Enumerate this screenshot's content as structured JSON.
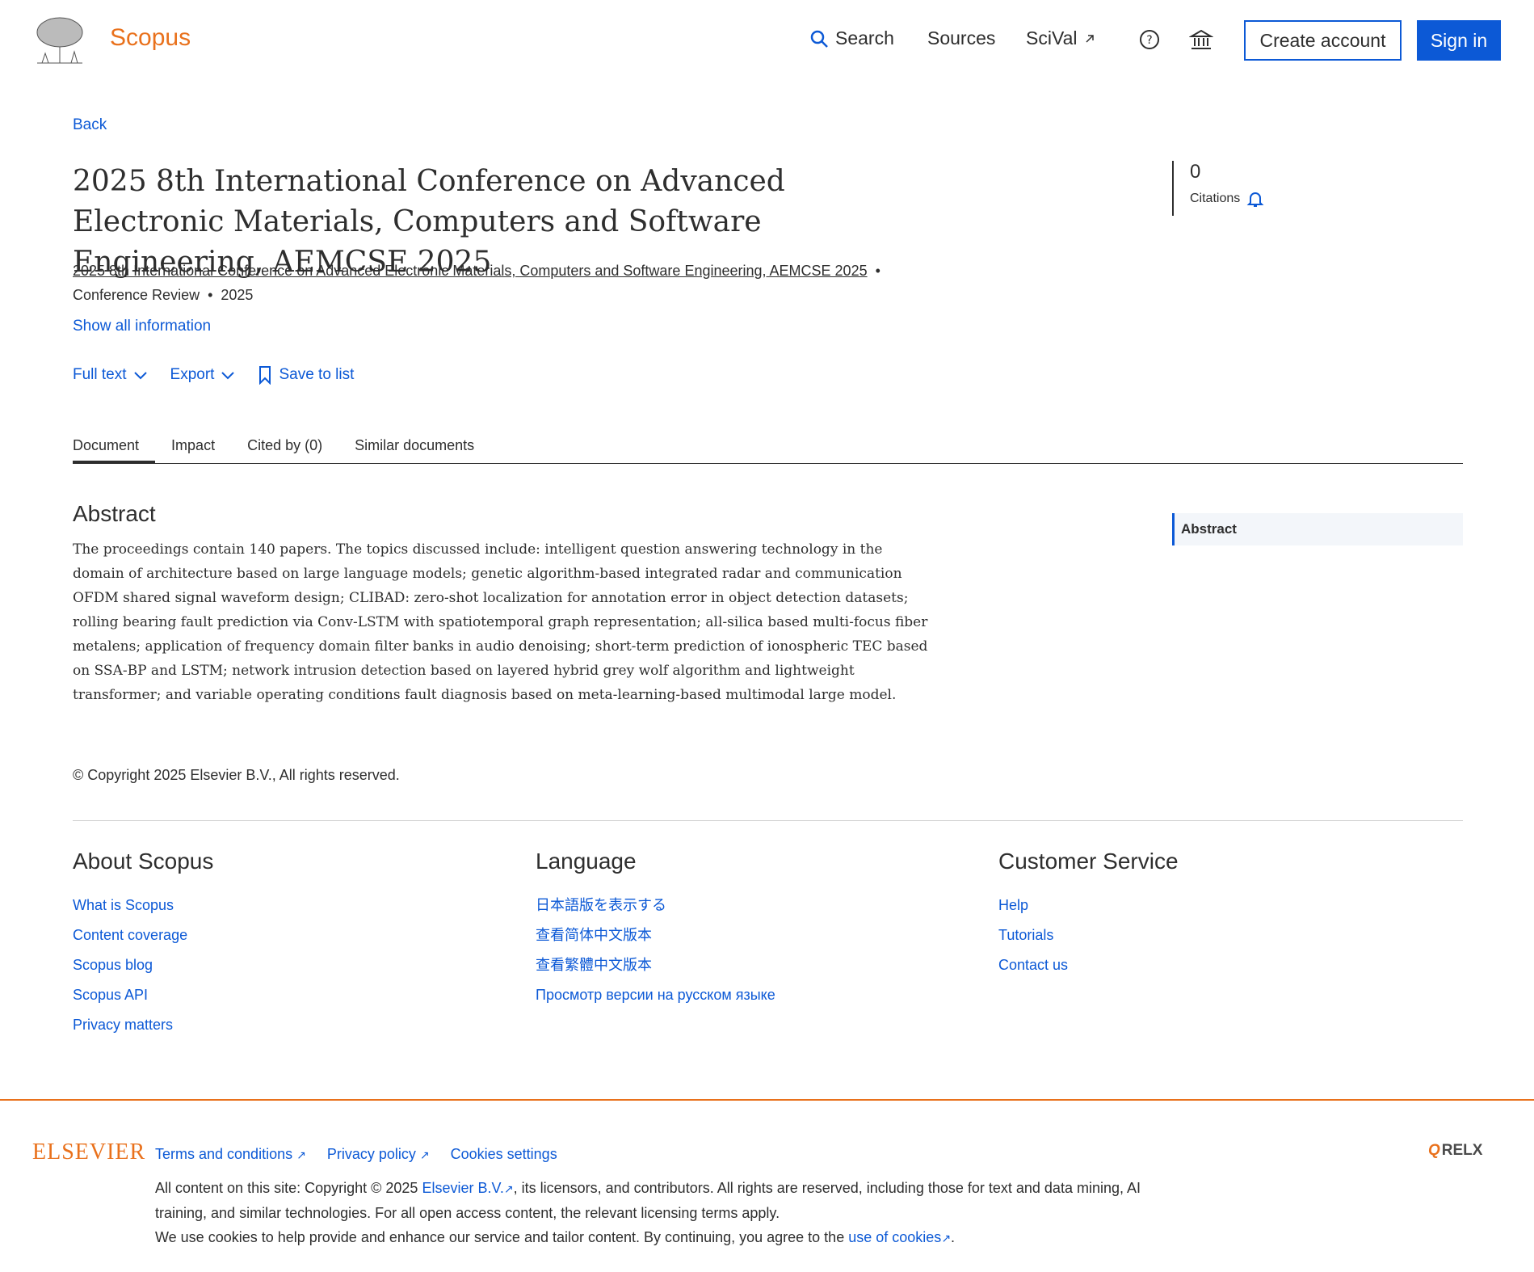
{
  "header": {
    "brand": "Scopus",
    "nav_search": "Search",
    "nav_sources": "Sources",
    "nav_scival": "SciVal",
    "create_account": "Create account",
    "sign_in": "Sign in",
    "icons": [
      "search-icon",
      "external-link-icon",
      "help-icon",
      "institution-icon"
    ]
  },
  "document": {
    "back": "Back",
    "title": "2025 8th International Conference on Advanced Electronic Materials, Computers and Software Engineering, AEMCSE 2025",
    "source": "2025 8th International Conference on Advanced Electronic Materials, Computers and Software Engineering, AEMCSE 2025",
    "doc_type": "Conference Review",
    "year": "2025",
    "show_all": "Show all information",
    "actions": {
      "full_text": "Full text",
      "export": "Export",
      "save_to_list": "Save to list"
    },
    "citations": {
      "count": "0",
      "label": "Citations"
    },
    "tabs": [
      "Document",
      "Impact",
      "Cited by (0)",
      "Similar documents"
    ],
    "abstract_heading": "Abstract",
    "abstract": "The proceedings contain 140 papers. The topics discussed include: intelligent question answering technology in the domain of architecture based on large language models; genetic algorithm-based integrated radar and communication OFDM shared signal waveform design; CLIBAD: zero-shot localization for annotation error in object detection datasets; rolling bearing fault prediction via Conv-LSTM with spatiotemporal graph representation; all-silica based multi-focus fiber metalens; application of frequency domain filter banks in audio denoising; short-term prediction of ionospheric TEC based on SSA-BP and LSTM; network intrusion detection based on layered hybrid grey wolf algorithm and lightweight transformer; and variable operating conditions fault diagnosis based on meta-learning-based multimodal large model.",
    "side_nav_abstract": "Abstract",
    "copyright": "Copyright 2025 Elsevier B.V., All rights reserved."
  },
  "footer": {
    "about": {
      "heading": "About Scopus",
      "links": [
        "What is Scopus",
        "Content coverage",
        "Scopus blog",
        "Scopus API",
        "Privacy matters"
      ]
    },
    "language": {
      "heading": "Language",
      "links": [
        "日本語版を表示する",
        "查看简体中文版本",
        "查看繁體中文版本",
        "Просмотр версии на русском языке"
      ]
    },
    "service": {
      "heading": "Customer Service",
      "links": [
        "Help",
        "Tutorials",
        "Contact us"
      ]
    },
    "elsevier_logo": "ELSEVIER",
    "legal_links": [
      "Terms and conditions",
      "Privacy policy",
      "Cookies settings"
    ],
    "legal_line1_a": "All content on this site: Copyright © 2025",
    "legal_line1_link": "Elsevier B.V.",
    "legal_line1_b": ", its licensors, and contributors. All rights are reserved, including those for text and data mining, AI training, and similar technologies. For all open access content, the relevant licensing terms apply.",
    "legal_line2_a": "We use cookies to help provide and enhance our service and tailor content. By continuing, you agree to the",
    "legal_line2_link": "use of cookies",
    "relx": "RELX"
  }
}
